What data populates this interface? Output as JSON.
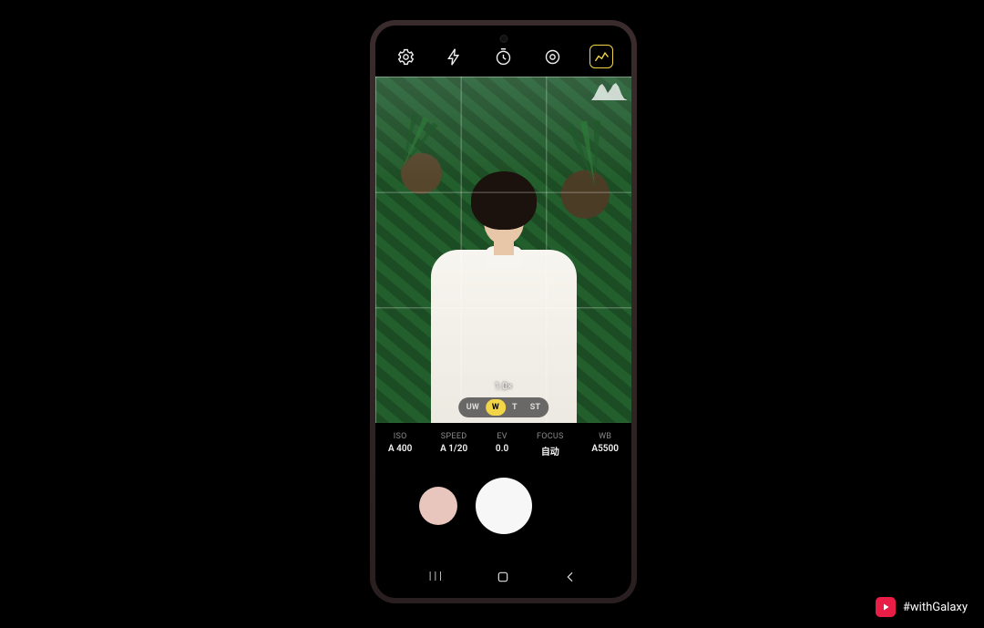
{
  "top_icons": {
    "settings": "settings",
    "flash": "flash",
    "timer": "timer",
    "ratio": "ratio",
    "metering_active": "metering"
  },
  "viewfinder": {
    "zoom_label": "1.0×",
    "lens_tabs": [
      "UW",
      "W",
      "T",
      "ST"
    ],
    "lens_active_index": 1
  },
  "params": [
    {
      "label": "ISO",
      "value": "A 400"
    },
    {
      "label": "SPEED",
      "value": "A 1/20"
    },
    {
      "label": "EV",
      "value": "0.0"
    },
    {
      "label": "FOCUS",
      "value": "自动"
    },
    {
      "label": "WB",
      "value": "A5500"
    }
  ],
  "badge": {
    "text": "#withGalaxy"
  }
}
